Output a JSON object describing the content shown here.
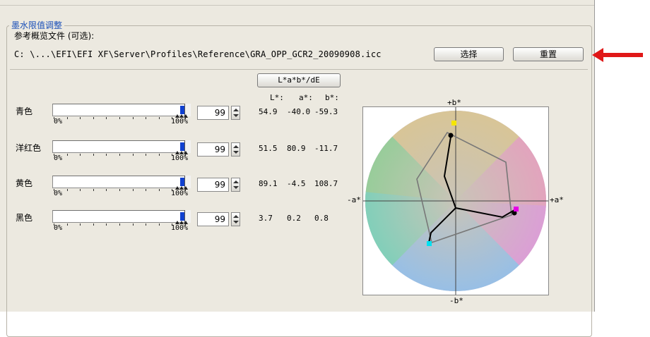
{
  "group": {
    "title": "墨水限值调整",
    "ref_label": "参考概览文件 (可选):",
    "ref_path": "C: \\...\\EFI\\EFI XF\\Server\\Profiles\\Reference\\GRA_OPP_GCR2_20090908.icc",
    "select_label": "选择",
    "reset_label": "重置",
    "mode_label": "L*a*b*/dE"
  },
  "header": {
    "L": "L*:",
    "a": "a*:",
    "b": "b*:"
  },
  "inks": [
    {
      "name": "青色",
      "value": "99",
      "fill_color": "#1040d0",
      "L": "54.9",
      "a": "-40.0",
      "b": "-59.3",
      "min": "0%",
      "max": "100%"
    },
    {
      "name": "洋红色",
      "value": "99",
      "fill_color": "#1040d0",
      "L": "51.5",
      "a": "80.9",
      "b": "-11.7",
      "min": "0%",
      "max": "100%"
    },
    {
      "name": "黄色",
      "value": "99",
      "fill_color": "#1040d0",
      "L": "89.1",
      "a": "-4.5",
      "b": "108.7",
      "min": "0%",
      "max": "100%"
    },
    {
      "name": "黑色",
      "value": "99",
      "fill_color": "#1040d0",
      "L": "3.7",
      "a": "0.2",
      "b": "0.8",
      "min": "0%",
      "max": "100%"
    }
  ],
  "plot": {
    "plus_b": "+b*",
    "minus_b": "-b*",
    "plus_a": "+a*",
    "minus_a": "-a*"
  },
  "accent_colors": {
    "arrow": "#e01818",
    "legend": "#1a4fb8"
  }
}
